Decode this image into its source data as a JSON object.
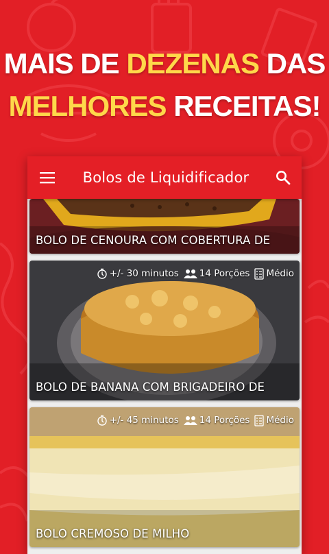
{
  "promo": {
    "line1_a": "MAIS DE ",
    "line1_b": "DEZENAS",
    "line1_c": " DAS",
    "line2_a": "MELHORES",
    "line2_b": " RECEITAS!"
  },
  "appbar": {
    "title": "Bolos de Liquidificador",
    "menu_icon": "menu-icon",
    "search_icon": "search-icon"
  },
  "recipes": [
    {
      "title": "BOLO DE CENOURA COM COBERTURA DE"
    },
    {
      "title": "BOLO DE BANANA COM BRIGADEIRO DE",
      "time": "+/- 30 minutos",
      "servings": "14 Porções",
      "difficulty": "Médio"
    },
    {
      "title": "BOLO CREMOSO DE MILHO",
      "time": "+/- 45 minutos",
      "servings": "14 Porções",
      "difficulty": "Médio"
    }
  ],
  "colors": {
    "background": "#e21f26",
    "highlight": "#ffd84a",
    "appbar": "#e41f26"
  }
}
